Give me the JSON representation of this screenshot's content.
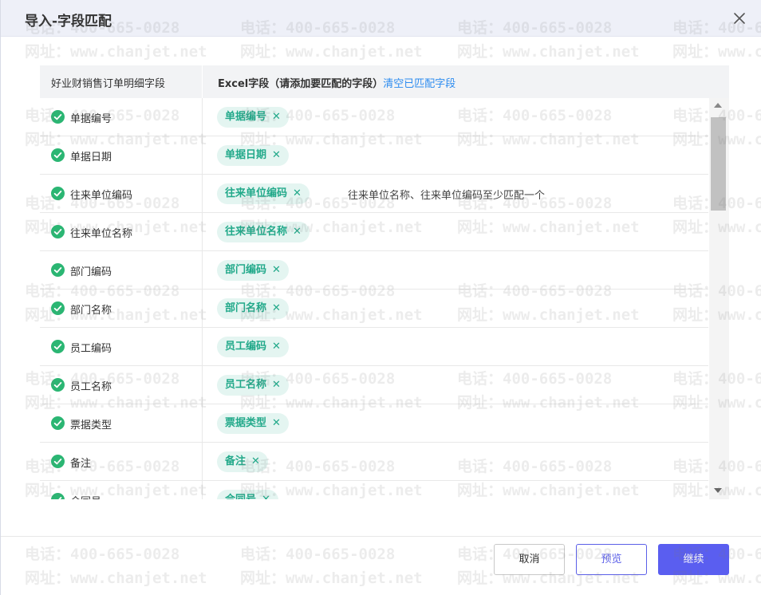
{
  "dialog": {
    "title": "导入-字段匹配"
  },
  "table": {
    "left_header": "好业财销售订单明细字段",
    "right_header": "Excel字段（请添加要匹配的字段）",
    "clear_link": "清空已匹配字段",
    "rows": [
      {
        "field": "单据编号",
        "tag": "单据编号",
        "note": ""
      },
      {
        "field": "单据日期",
        "tag": "单据日期",
        "note": ""
      },
      {
        "field": "往来单位编码",
        "tag": "往来单位编码",
        "note": "往来单位名称、往来单位编码至少匹配一个"
      },
      {
        "field": "往来单位名称",
        "tag": "往来单位名称",
        "note": ""
      },
      {
        "field": "部门编码",
        "tag": "部门编码",
        "note": ""
      },
      {
        "field": "部门名称",
        "tag": "部门名称",
        "note": ""
      },
      {
        "field": "员工编码",
        "tag": "员工编码",
        "note": ""
      },
      {
        "field": "员工名称",
        "tag": "员工名称",
        "note": ""
      },
      {
        "field": "票据类型",
        "tag": "票据类型",
        "note": ""
      },
      {
        "field": "备注",
        "tag": "备注",
        "note": ""
      },
      {
        "field": "合同号",
        "tag": "合同号",
        "note": ""
      }
    ],
    "remove_glyph": "✕"
  },
  "watermark": {
    "phone": "电话：400-665-0028",
    "site": "网址：www.chanjet.net"
  },
  "footer": {
    "cancel_label": "取消",
    "preview_label": "预览",
    "continue_label": "继续"
  },
  "colors": {
    "accent": "#5a5ef0",
    "tag_bg": "#e4f5f1",
    "tag_text": "#22a98a",
    "check_green": "#2bb673",
    "link": "#2d8cf0"
  },
  "icons": {
    "close": "close-icon",
    "check": "check-circle-icon",
    "remove": "close-small-icon"
  }
}
